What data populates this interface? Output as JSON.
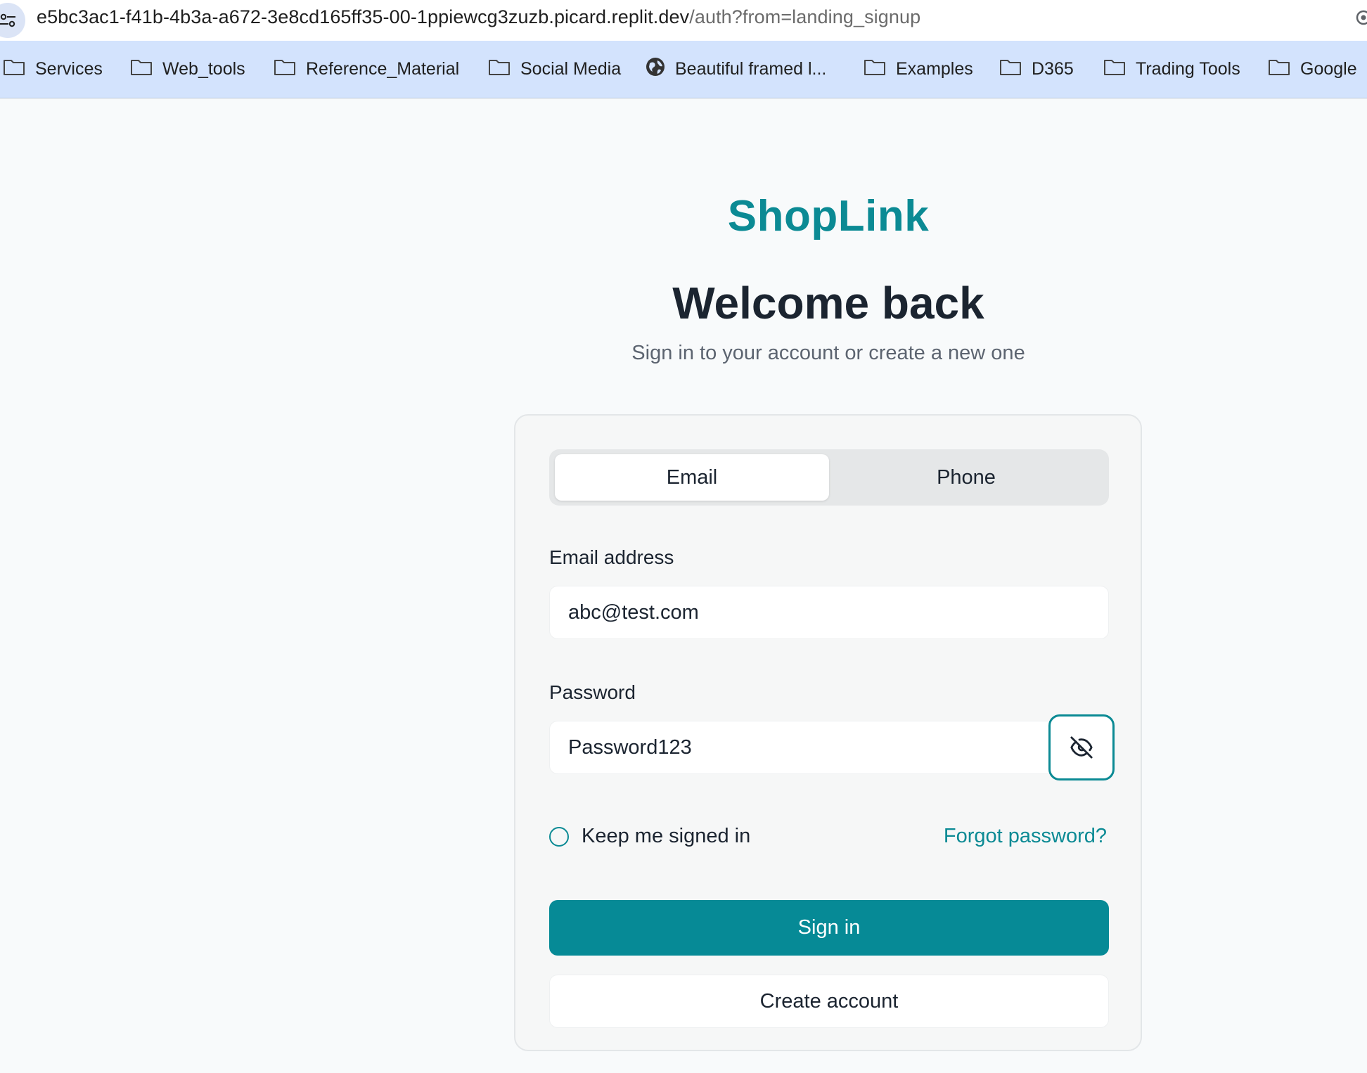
{
  "browser": {
    "url_host": "e5bc3ac1-f41b-4b3a-a672-3e8cd165ff35-00-1ppiewcg3zuzb.picard.replit.dev",
    "url_path": "/auth?from=landing_signup",
    "bookmarks": [
      {
        "label": "Services",
        "icon": "folder-icon"
      },
      {
        "label": "Web_tools",
        "icon": "folder-icon"
      },
      {
        "label": "Reference_Material",
        "icon": "folder-icon"
      },
      {
        "label": "Social Media",
        "icon": "folder-icon"
      },
      {
        "label": "Beautiful framed l...",
        "icon": "globe-icon"
      },
      {
        "label": "Examples",
        "icon": "folder-icon"
      },
      {
        "label": "D365",
        "icon": "folder-icon"
      },
      {
        "label": "Trading Tools",
        "icon": "folder-icon"
      },
      {
        "label": "Google",
        "icon": "folder-icon"
      }
    ]
  },
  "page": {
    "brand": "ShopLink",
    "title": "Welcome back",
    "subtitle": "Sign in to your account or create a new one"
  },
  "form": {
    "tabs": [
      {
        "label": "Email",
        "active": true
      },
      {
        "label": "Phone",
        "active": false
      }
    ],
    "email_label": "Email address",
    "email_value": "abc@test.com",
    "password_label": "Password",
    "password_value": "Password123",
    "toggle_icon": "eye-off-icon",
    "remember_label": "Keep me signed in",
    "remember_checked": false,
    "forgot_label": "Forgot password?",
    "signin_label": "Sign in",
    "create_label": "Create account"
  },
  "colors": {
    "brand": "#0b8a94",
    "primary_button": "#068a96",
    "bookmarks_bar": "#d3e3fd",
    "page_background": "#f8fafb"
  }
}
